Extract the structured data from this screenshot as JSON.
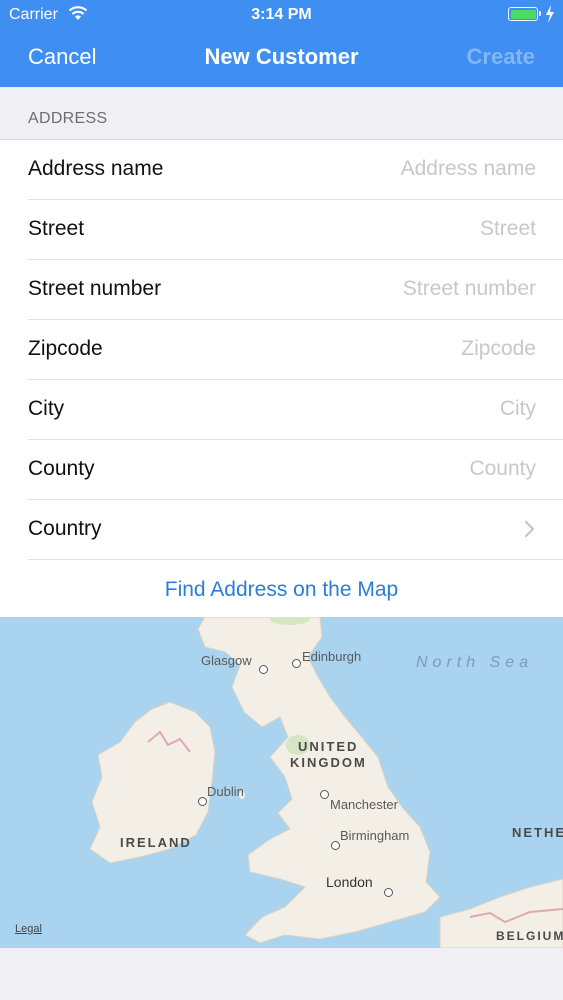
{
  "status_bar": {
    "carrier": "Carrier",
    "time": "3:14 PM",
    "battery_color": "#4cd964"
  },
  "nav": {
    "cancel_label": "Cancel",
    "title": "New Customer",
    "create_label": "Create",
    "background": "#3f8ef2"
  },
  "address_section": {
    "header": "ADDRESS",
    "fields": [
      {
        "label": "Address name",
        "value": "",
        "placeholder": "Address name"
      },
      {
        "label": "Street",
        "value": "",
        "placeholder": "Street"
      },
      {
        "label": "Street number",
        "value": "",
        "placeholder": "Street number"
      },
      {
        "label": "Zipcode",
        "value": "",
        "placeholder": "Zipcode"
      },
      {
        "label": "City",
        "value": "",
        "placeholder": "City"
      },
      {
        "label": "County",
        "value": "",
        "placeholder": "County"
      }
    ],
    "country_label": "Country",
    "find_label": "Find Address on the Map"
  },
  "map": {
    "cities": [
      "Glasgow",
      "Edinburgh",
      "Dublin",
      "Manchester",
      "Birmingham",
      "London"
    ],
    "countries": [
      "UNITED",
      "KINGDOM",
      "IRELAND",
      "NETHE",
      "BELGIUM"
    ],
    "sea": "North Sea",
    "legal": "Legal",
    "water_color": "#a9d3ef",
    "land_color": "#f3efe6"
  }
}
